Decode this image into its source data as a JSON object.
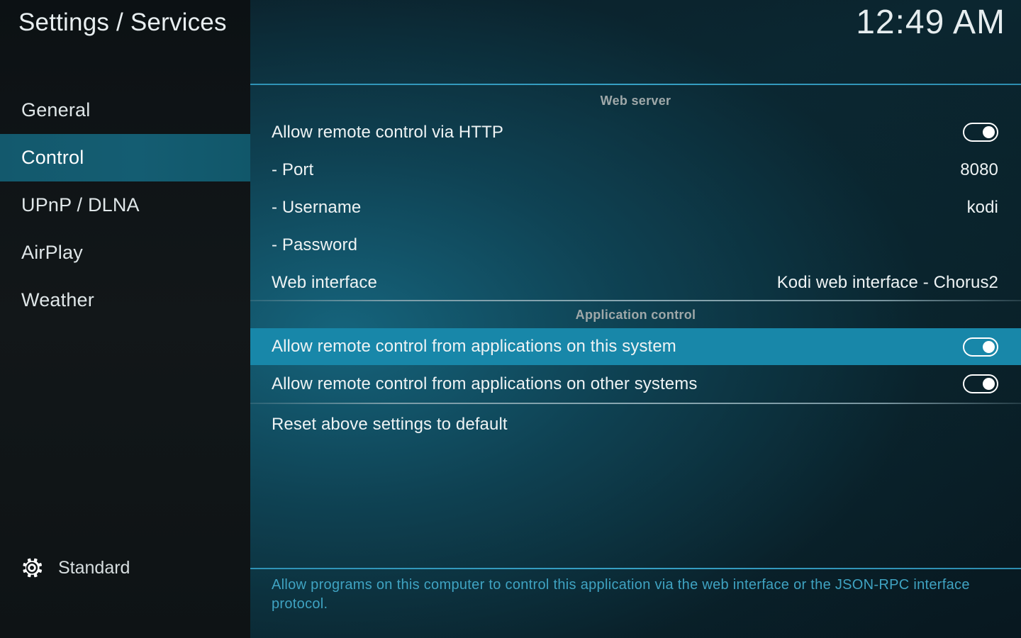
{
  "header": {
    "title": "Settings / Services",
    "clock": "12:49 AM"
  },
  "sidebar": {
    "items": [
      {
        "label": "General",
        "selected": false
      },
      {
        "label": "Control",
        "selected": true
      },
      {
        "label": "UPnP / DLNA",
        "selected": false
      },
      {
        "label": "AirPlay",
        "selected": false
      },
      {
        "label": "Weather",
        "selected": false
      }
    ],
    "profile": {
      "icon": "gear-icon",
      "label": "Standard"
    }
  },
  "main": {
    "sections": [
      {
        "header": "Web server",
        "rows": [
          {
            "label": "Allow remote control via HTTP",
            "control": "toggle",
            "value": "on",
            "highlighted": false
          },
          {
            "label": "- Port",
            "control": "value",
            "value": "8080",
            "highlighted": false
          },
          {
            "label": "- Username",
            "control": "value",
            "value": "kodi",
            "highlighted": false
          },
          {
            "label": "- Password",
            "control": "value",
            "value": "",
            "highlighted": false
          },
          {
            "label": "Web interface",
            "control": "value",
            "value": "Kodi web interface - Chorus2",
            "highlighted": false
          }
        ]
      },
      {
        "header": "Application control",
        "rows": [
          {
            "label": "Allow remote control from applications on this system",
            "control": "toggle",
            "value": "on",
            "highlighted": true
          },
          {
            "label": "Allow remote control from applications on other systems",
            "control": "toggle",
            "value": "on",
            "highlighted": false
          },
          {
            "label": "Reset above settings to default",
            "control": "none",
            "value": "",
            "highlighted": false
          }
        ]
      }
    ],
    "description": "Allow programs on this computer to control this application via the web interface or the JSON-RPC interface protocol."
  },
  "colors": {
    "accent_highlight": "#1887a9",
    "sidebar_selected": "#145d72",
    "divider_cyan": "#36a0c4",
    "description_text": "#3fa3c2",
    "section_header_text": "#9fa8a9"
  }
}
